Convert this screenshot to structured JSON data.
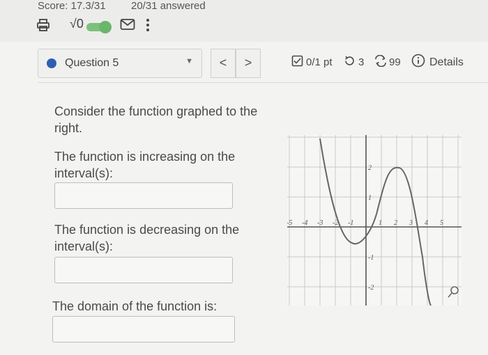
{
  "header": {
    "score": "Score: 17.3/31",
    "answered": "20/31 answered",
    "sqrt_label": "√0"
  },
  "question_nav": {
    "question_label": "Question 5",
    "prev_label": "<",
    "next_label": ">"
  },
  "meta": {
    "points": "0/1 pt",
    "attempts": "3",
    "submissions": "99",
    "details": "Details"
  },
  "prompts": {
    "intro": "Consider the function graphed to the right.",
    "increasing": "The function is increasing on the interval(s):",
    "decreasing": "The function is decreasing on the interval(s):",
    "domain": "The domain of the function is:"
  },
  "graph": {
    "x_ticks": [
      "-5",
      "-4",
      "-3",
      "-2",
      "-1",
      "1",
      "2",
      "3",
      "4",
      "5"
    ],
    "y_ticks": [
      "2",
      "1",
      "-1",
      "-2"
    ]
  },
  "colors": {
    "accent": "#2f5fb3",
    "toggle": "#7bc17c",
    "curve": "#666666"
  }
}
